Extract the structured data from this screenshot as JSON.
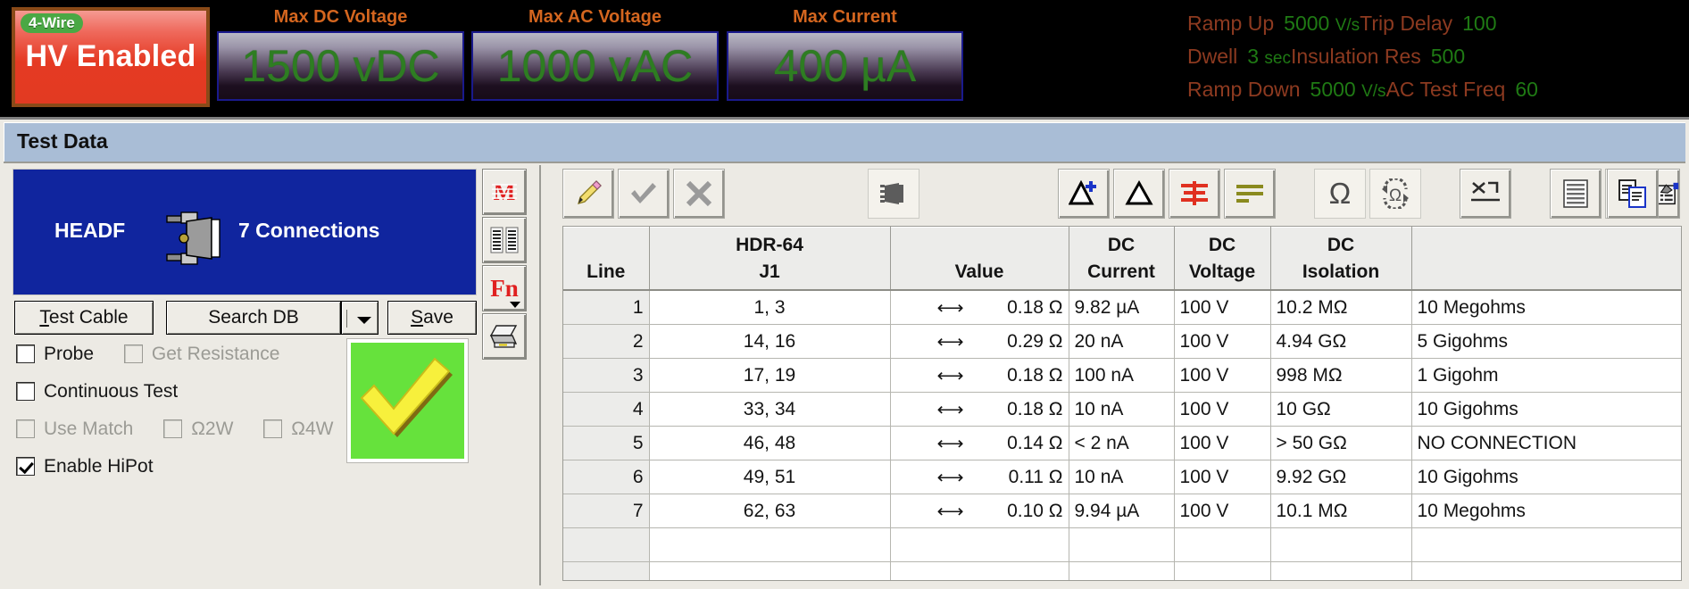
{
  "status_bar": {
    "hv_badge": "4-Wire",
    "hv_state": "HV Enabled",
    "meters": [
      {
        "caption": "Max DC Voltage",
        "value": "1500 vDC"
      },
      {
        "caption": "Max AC Voltage",
        "value": "1000 vAC"
      },
      {
        "caption": "Max Current",
        "value": "400 µA"
      }
    ],
    "params": [
      {
        "name": "Ramp Up",
        "value": "5000",
        "unit": "V/s"
      },
      {
        "name": "Dwell",
        "value": "3",
        "unit": "sec"
      },
      {
        "name": "Ramp Down",
        "value": "5000",
        "unit": "V/s"
      }
    ],
    "params2": [
      {
        "name": "Trip Delay",
        "value": "100",
        "unit": ""
      },
      {
        "name": "Insulation Res",
        "value": "500",
        "unit": ""
      },
      {
        "name": "AC Test Freq",
        "value": "60",
        "unit": ""
      }
    ]
  },
  "window": {
    "title": "Test Data"
  },
  "left_panel": {
    "connector_name": "HEADF",
    "connection_count": "7 Connections",
    "buttons": {
      "test_cable": "Test Cable",
      "test_cable_accel": "T",
      "search_db": "Search DB",
      "save": "Save",
      "save_accel": "S"
    },
    "checkboxes": [
      {
        "label": "Probe",
        "checked": false,
        "disabled": false
      },
      {
        "label": "Get Resistance",
        "checked": false,
        "disabled": true
      },
      {
        "label": "Continuous Test",
        "checked": false,
        "disabled": false
      },
      {
        "label": "Use Match",
        "checked": false,
        "disabled": true
      },
      {
        "label": "Ω2W",
        "checked": false,
        "disabled": true
      },
      {
        "label": "Ω4W",
        "checked": false,
        "disabled": true
      },
      {
        "label": "Enable HiPot",
        "checked": true,
        "disabled": false
      }
    ],
    "result": "pass-checkmark",
    "side_icons": [
      {
        "name": "netlist-icon",
        "glyph": "M"
      },
      {
        "name": "list-columns-icon",
        "glyph": ""
      },
      {
        "name": "function-keys-icon",
        "glyph": "Fn"
      },
      {
        "name": "print-icon",
        "glyph": ""
      }
    ]
  },
  "toolbar": {
    "buttons": [
      {
        "name": "edit-pencil-icon",
        "label": "Edit"
      },
      {
        "name": "accept-check-icon",
        "label": "Accept"
      },
      {
        "name": "cancel-x-icon",
        "label": "Cancel"
      },
      {
        "name": "connector-icon",
        "label": "Connector"
      },
      {
        "name": "add-net-icon",
        "label": "Add Net"
      },
      {
        "name": "net-icon",
        "label": "Net"
      },
      {
        "name": "sort-red-icon",
        "label": "Sort"
      },
      {
        "name": "sort-olive-icon",
        "label": "Group"
      },
      {
        "name": "ohm-icon",
        "label": "Resistance"
      },
      {
        "name": "refresh-ohm-icon",
        "label": "Retest"
      },
      {
        "name": "measure-icon",
        "label": "Measure"
      },
      {
        "name": "single-column-view-icon",
        "label": "Single Column View"
      },
      {
        "name": "double-column-view-icon",
        "label": "Double Column View"
      },
      {
        "name": "properties-icon",
        "label": "Properties"
      },
      {
        "name": "copy-icon",
        "label": "Copy"
      }
    ]
  },
  "table": {
    "columns": [
      {
        "line1": "",
        "line2": "Line"
      },
      {
        "line1": "HDR-64",
        "line2": "J1"
      },
      {
        "line1": "",
        "line2": "Value"
      },
      {
        "line1": "DC",
        "line2": "Current"
      },
      {
        "line1": "DC",
        "line2": "Voltage"
      },
      {
        "line1": "DC",
        "line2": "Isolation"
      },
      {
        "line1": "",
        "line2": ""
      }
    ],
    "rows": [
      {
        "line": "1",
        "pins": "1, 3",
        "value": "0.18 Ω",
        "dc_current": "9.82 µA",
        "dc_voltage": "100 V",
        "dc_isolation": "10.2 MΩ",
        "note": "10 Megohms"
      },
      {
        "line": "2",
        "pins": "14, 16",
        "value": "0.29 Ω",
        "dc_current": "20 nA",
        "dc_voltage": "100 V",
        "dc_isolation": "4.94 GΩ",
        "note": "5 Gigohms"
      },
      {
        "line": "3",
        "pins": "17, 19",
        "value": "0.18 Ω",
        "dc_current": "100 nA",
        "dc_voltage": "100 V",
        "dc_isolation": "998 MΩ",
        "note": "1 Gigohm"
      },
      {
        "line": "4",
        "pins": "33, 34",
        "value": "0.18 Ω",
        "dc_current": "10 nA",
        "dc_voltage": "100 V",
        "dc_isolation": "10 GΩ",
        "note": "10 Gigohms"
      },
      {
        "line": "5",
        "pins": "46, 48",
        "value": "0.14 Ω",
        "dc_current": "< 2 nA",
        "dc_voltage": "100 V",
        "dc_isolation": "> 50 GΩ",
        "note": "NO CONNECTION"
      },
      {
        "line": "6",
        "pins": "49, 51",
        "value": "0.11 Ω",
        "dc_current": "10 nA",
        "dc_voltage": "100 V",
        "dc_isolation": "9.92 GΩ",
        "note": "10 Gigohms"
      },
      {
        "line": "7",
        "pins": "62, 63",
        "value": "0.10 Ω",
        "dc_current": "9.94 µA",
        "dc_voltage": "100 V",
        "dc_isolation": "10.1 MΩ",
        "note": "10 Megohms"
      }
    ]
  },
  "colors": {
    "hv_red": "#e53a23",
    "badge_green": "#4aa844",
    "meter_green": "#2e7d22",
    "caption_orange": "#d4661f",
    "param_name": "#8d3a20",
    "param_value": "#1f7a14",
    "title_blue": "#a9bdd6",
    "connector_blue": "#10259e",
    "pass_green": "#66e23c"
  }
}
